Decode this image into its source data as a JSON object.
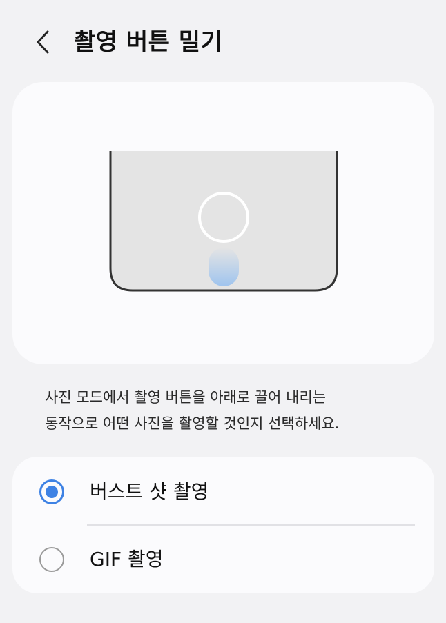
{
  "header": {
    "title": "촬영 버튼 밀기",
    "back_icon": "chevron-left-icon"
  },
  "illustration": {
    "icon": "phone-shutter-swipe-icon",
    "colors": {
      "phone_body": "#e4e4e4",
      "phone_outline": "#333333",
      "shutter_ring": "#ffffff",
      "swipe_trail": "#9fc4ee"
    }
  },
  "description": {
    "line1": "사진 모드에서 촬영 버튼을 아래로 끌어 내리는",
    "line2": "동작으로 어떤 사진을 촬영할 것인지 선택하세요."
  },
  "options": [
    {
      "label": "버스트 샷 촬영",
      "selected": true
    },
    {
      "label": "GIF 촬영",
      "selected": false
    }
  ],
  "colors": {
    "accent": "#3e82e4",
    "background": "#f2f2f4",
    "card": "#fbfbfd"
  }
}
